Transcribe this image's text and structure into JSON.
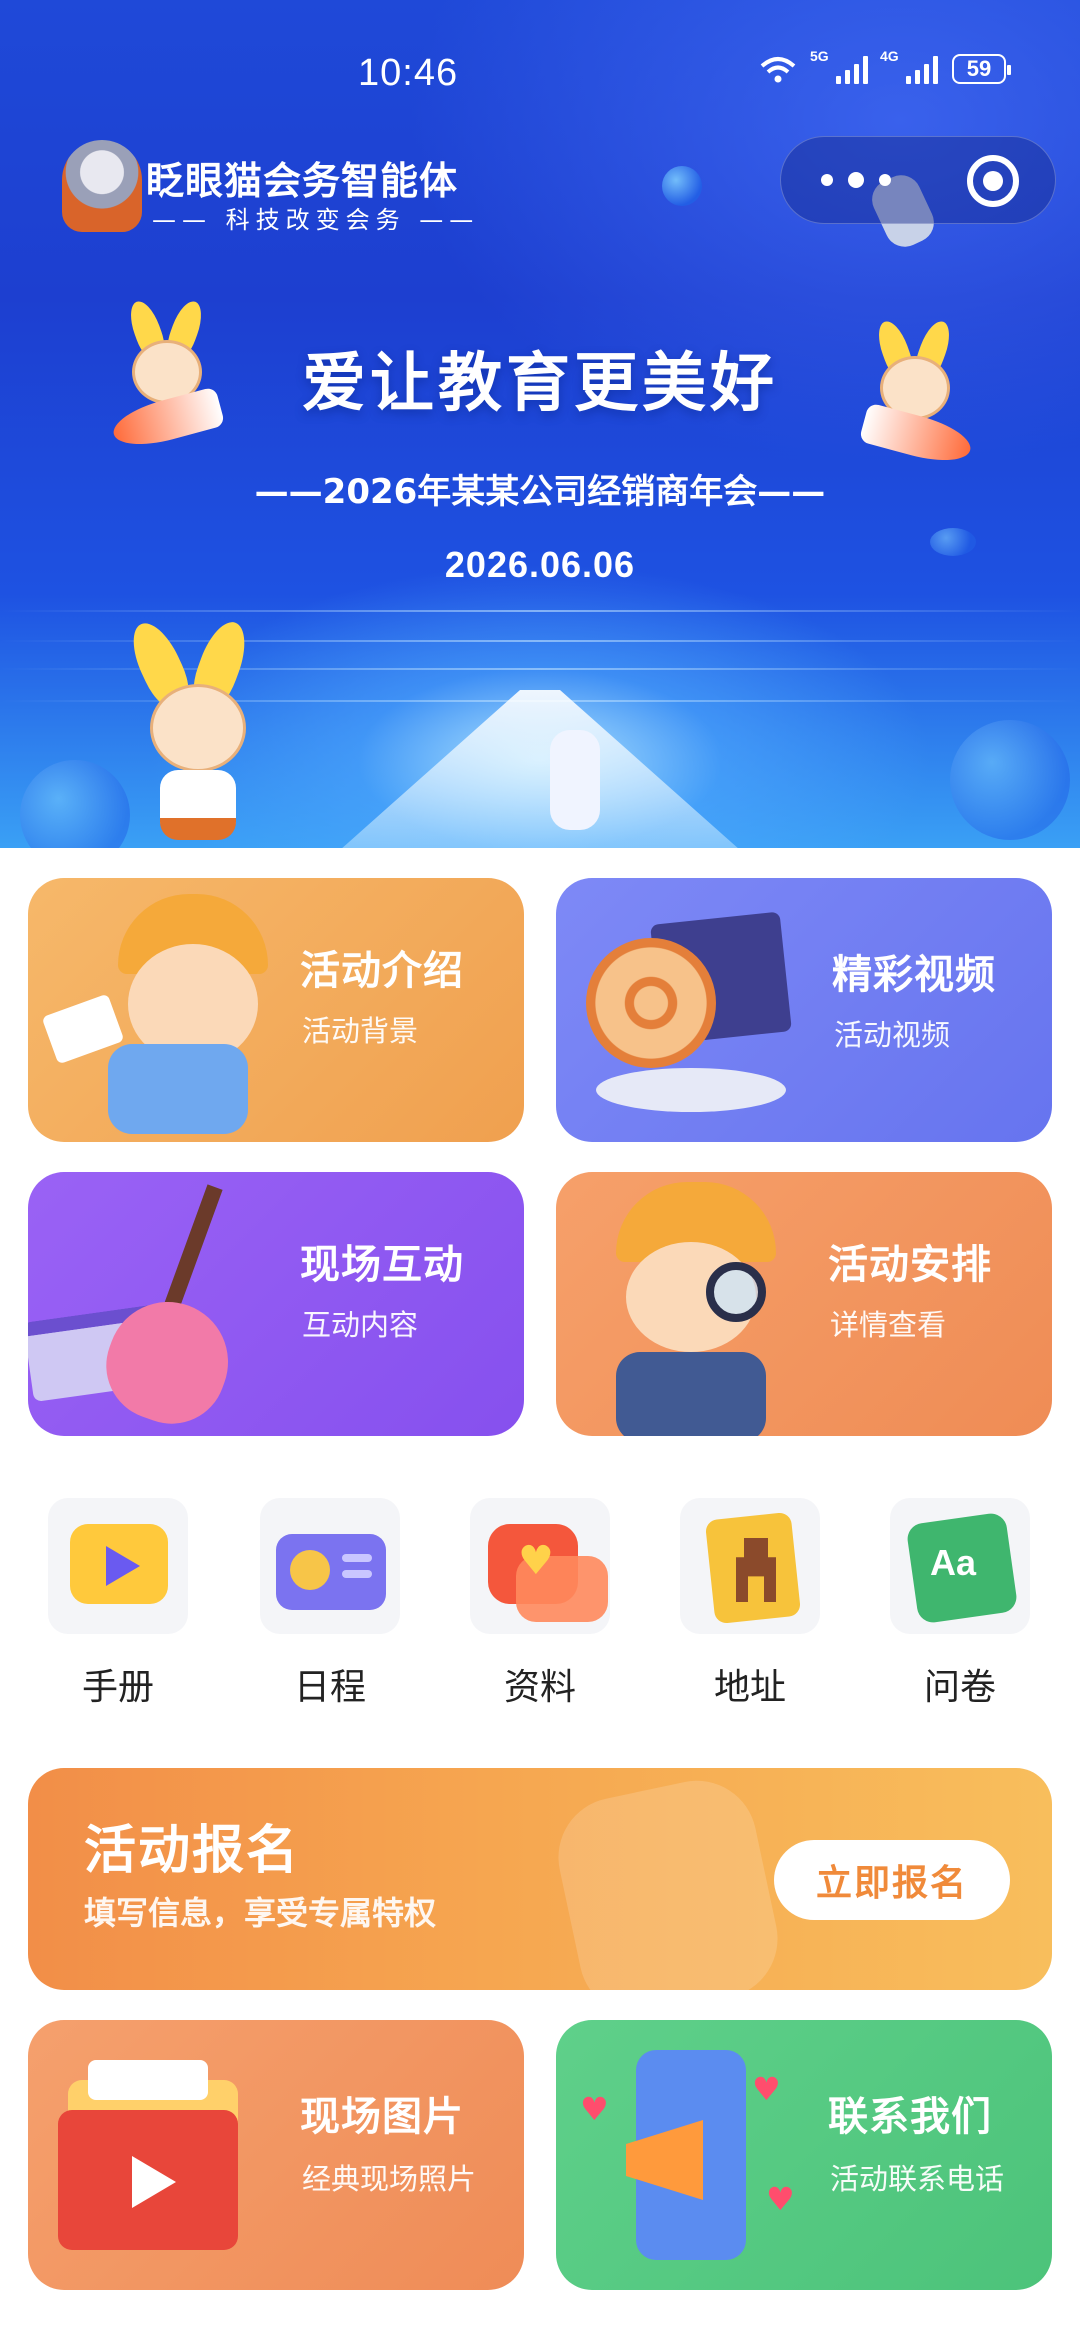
{
  "status_bar": {
    "time": "10:46",
    "network_1": "5G",
    "network_2": "4G",
    "battery": "59"
  },
  "brand": {
    "name": "眨眼猫会务智能体",
    "slogan": "—— 科技改变会务 ——"
  },
  "hero": {
    "title": "爱让教育更美好",
    "subtitle": "——2026年某某公司经销商年会——",
    "date": "2026.06.06"
  },
  "cards": {
    "intro": {
      "title": "活动介绍",
      "sub": "活动背景",
      "color": "#f3ac5c"
    },
    "video": {
      "title": "精彩视频",
      "sub": "活动视频",
      "color": "#7280f2"
    },
    "interact": {
      "title": "现场互动",
      "sub": "互动内容",
      "color": "#8f58f1"
    },
    "schedule": {
      "title": "活动安排",
      "sub": "详情查看",
      "color": "#f29660"
    },
    "photos": {
      "title": "现场图片",
      "sub": "经典现场照片",
      "color": "#f29660"
    },
    "contact": {
      "title": "联系我们",
      "sub": "活动联系电话",
      "color": "#56ca82"
    }
  },
  "quick_links": [
    {
      "label": "手册",
      "icon": "play-screen-icon"
    },
    {
      "label": "日程",
      "icon": "radio-icon"
    },
    {
      "label": "资料",
      "icon": "heart-chat-icon"
    },
    {
      "label": "地址",
      "icon": "giraffe-book-icon"
    },
    {
      "label": "问卷",
      "icon": "aa-note-icon"
    }
  ],
  "register": {
    "title": "活动报名",
    "sub": "填写信息，享受专属特权",
    "button": "立即报名"
  }
}
